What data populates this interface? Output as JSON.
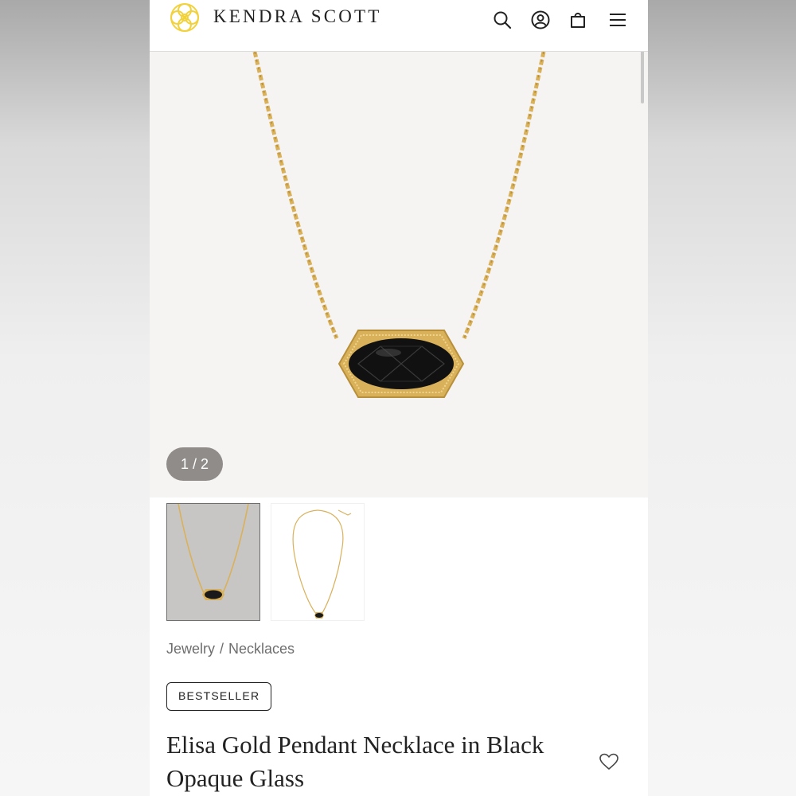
{
  "header": {
    "brand": "KENDRA SCOTT",
    "icons": [
      "logo-icon",
      "search-icon",
      "account-icon",
      "bag-icon",
      "menu-icon"
    ]
  },
  "gallery": {
    "counter": "1 / 2",
    "current_image": 1,
    "total_images": 2
  },
  "breadcrumb": {
    "items": [
      "Jewelry",
      "Necklaces"
    ],
    "separator": "/"
  },
  "product": {
    "badge": "BESTSELLER",
    "title": "Elisa Gold Pendant Necklace in Black Opaque Glass"
  },
  "colors": {
    "gold": "#d9b15a",
    "stone": "#111111",
    "logo_yellow": "#f2d23c",
    "counter_bg": "#8f8c8a"
  }
}
